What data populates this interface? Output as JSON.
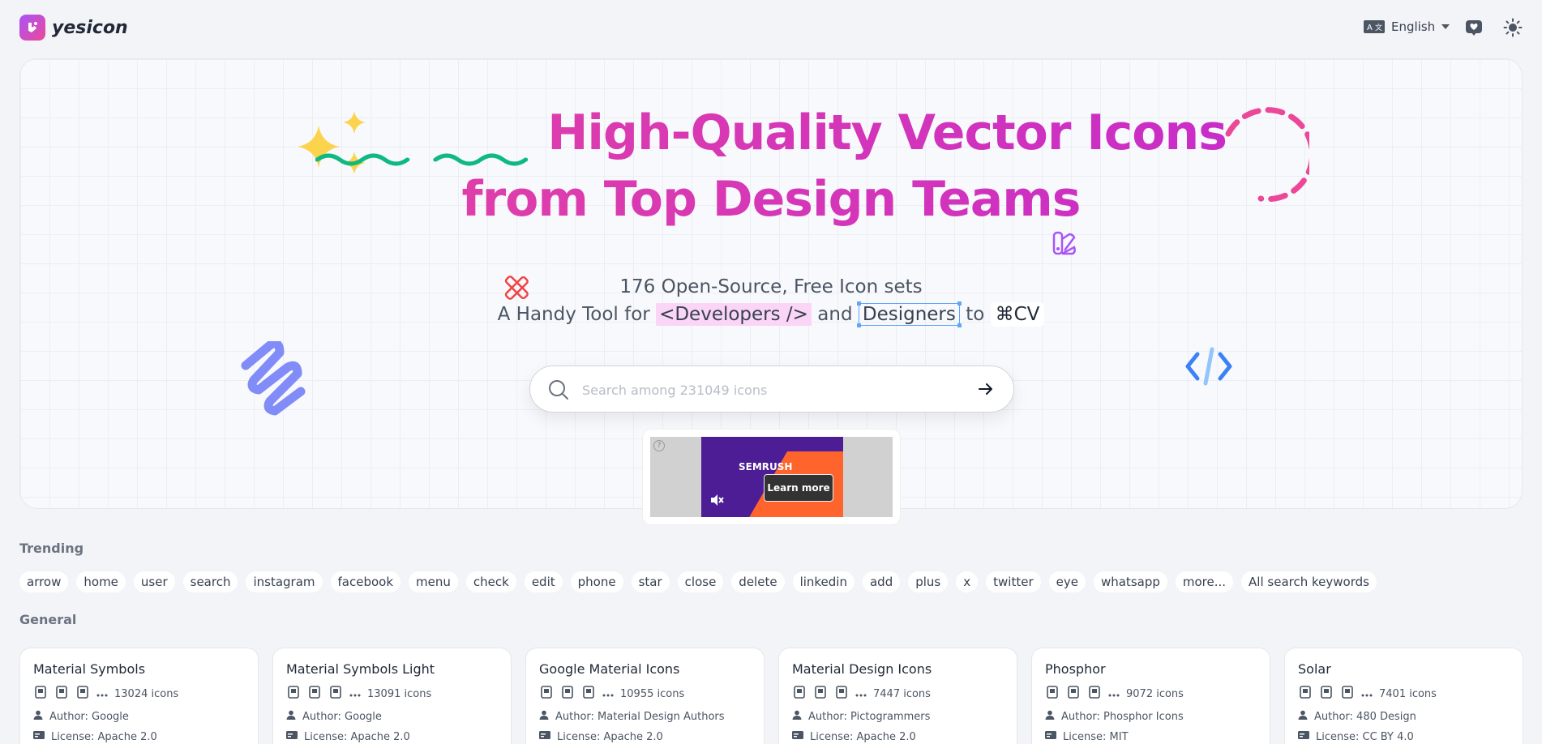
{
  "brand": {
    "name": "yesicon"
  },
  "header": {
    "language": "English"
  },
  "hero": {
    "count": "231,049",
    "title_rest": "High-Quality Vector Icons",
    "title_line2": "from Top Design Teams",
    "subtitle": "176 Open-Source, Free Icon sets",
    "tagline_prefix": "A Handy Tool for",
    "tag_developers": "<Developers />",
    "tagline_and": "and",
    "tag_designers": "Designers",
    "tagline_to": "to",
    "tag_kbd": "⌘CV"
  },
  "search": {
    "placeholder": "Search among 231049 icons"
  },
  "ad": {
    "brand": "SEMRUSH",
    "cta": "Learn more",
    "help": "?"
  },
  "trending": {
    "label": "Trending",
    "keywords": [
      "arrow",
      "home",
      "user",
      "search",
      "instagram",
      "facebook",
      "menu",
      "check",
      "edit",
      "phone",
      "star",
      "close",
      "delete",
      "linkedin",
      "add",
      "plus",
      "x",
      "twitter",
      "eye",
      "whatsapp",
      "more...",
      "All search keywords"
    ]
  },
  "general": {
    "label": "General",
    "sets": [
      {
        "name": "Material Symbols",
        "count": "13024 icons",
        "author": "Author: Google",
        "license": "License: Apache 2.0"
      },
      {
        "name": "Material Symbols Light",
        "count": "13091 icons",
        "author": "Author: Google",
        "license": "License: Apache 2.0"
      },
      {
        "name": "Google Material Icons",
        "count": "10955 icons",
        "author": "Author: Material Design Authors",
        "license": "License: Apache 2.0"
      },
      {
        "name": "Material Design Icons",
        "count": "7447 icons",
        "author": "Author: Pictogrammers",
        "license": "License: Apache 2.0"
      },
      {
        "name": "Phosphor",
        "count": "9072 icons",
        "author": "Author: Phosphor Icons",
        "license": "License: MIT"
      },
      {
        "name": "Solar",
        "count": "7401 icons",
        "author": "Author: 480 Design",
        "license": "License: CC BY 4.0"
      }
    ]
  },
  "colors": {
    "accent_pink": "#ec4899",
    "accent_purple": "#c026d3",
    "star_yellow": "#fcd34d",
    "squiggle_green": "#10b981"
  }
}
